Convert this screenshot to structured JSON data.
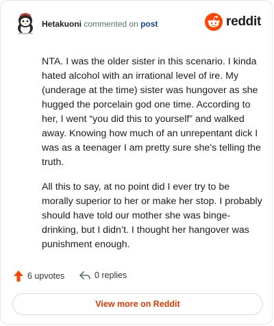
{
  "header": {
    "username": "Hetakuoni",
    "action_text": "commented on",
    "link_text": "post",
    "brand": "reddit"
  },
  "comment": {
    "paragraphs": [
      "NTA. I was the older sister in this scenario. I kinda hated alcohol with an irrational level of ire. My (underage at the time) sister was hungover as she hugged the porcelain god one time. According to her, I went “you did this to yourself” and walked away. Knowing how much of an unrepentant dick I was as a teenager I am pretty sure she’s telling the truth.",
      "All this to say, at no point did I ever try to be morally superior to her or make her stop. I probably should have told our mother she was binge-drinking, but I didn’t. I thought her hangover was punishment enough."
    ]
  },
  "footer": {
    "upvotes_label": "6 upvotes",
    "replies_label": "0 replies",
    "upvote_icon": "upvote-arrow-icon",
    "reply_icon": "reply-arrow-icon"
  },
  "view_more_label": "View more on Reddit",
  "colors": {
    "brand_orange": "#ff4500",
    "link_blue": "#0a449b",
    "cta_text": "#d93a00"
  }
}
